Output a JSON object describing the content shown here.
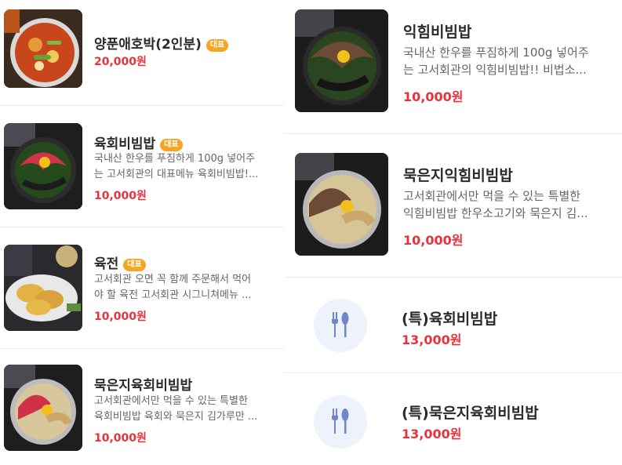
{
  "left_items": [
    {
      "name": "양푼애호박(2인분)",
      "badge": "대표",
      "price": "20,000원",
      "description": [],
      "thumb_icon": "stew-photo"
    },
    {
      "name": "육회비빔밥",
      "badge": "대표",
      "price": "10,000원",
      "description": [
        "국내산 한우를 푸짐하게 100g 넣어주",
        "는 고서회관의 대표메뉴 육회비빔밥!..."
      ],
      "thumb_icon": "yukhoe-bibimbap-photo"
    },
    {
      "name": "육전",
      "badge": "대표",
      "price": "10,000원",
      "description": [
        "고서회관 오면 꼭 함께 주문해서 먹어",
        "야 할 육전 고서회관 시그니쳐메뉴 ..."
      ],
      "thumb_icon": "yukjeon-photo"
    },
    {
      "name": "묵은지육회비빔밥",
      "badge": "",
      "price": "10,000원",
      "description": [
        "고서회관에서만 먹을 수 있는 특별한",
        "육회비빔밥 육회와 묵은지 김가루만 ..."
      ],
      "thumb_icon": "mukeunji-yukhoe-bibimbap-photo"
    }
  ],
  "right_items": [
    {
      "name": "익힘비빔밥",
      "price": "10,000원",
      "description": [
        "국내산 한우를 푸짐하게 100g 넣어주",
        "는 고서회관의 익힘비빔밥!! 비법소..."
      ],
      "thumb_icon": "cooked-beef-bibimbap-photo"
    },
    {
      "name": "묵은지익힘비빔밥",
      "price": "10,000원",
      "description": [
        "고서회관에서만 먹을 수 있는 특별한",
        "익힘비빔밥 한우소고기와 묵은지 김..."
      ],
      "thumb_icon": "mukeunji-cooked-bibimbap-photo"
    },
    {
      "name": "(특)육회비빔밥",
      "price": "13,000원",
      "description": [],
      "thumb_icon": "fork-spoon-placeholder-icon"
    },
    {
      "name": "(특)묵은지육회비빔밥",
      "price": "13,000원",
      "description": [],
      "thumb_icon": "fork-spoon-placeholder-icon"
    }
  ],
  "colors": {
    "price": "#e8323c",
    "badge": "#f5a524",
    "placeholder_bg": "#eef3fb",
    "placeholder_icon": "#6f86c8"
  }
}
